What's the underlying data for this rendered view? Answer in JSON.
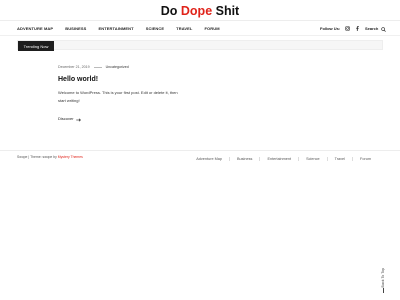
{
  "site": {
    "title_part1": "Do ",
    "title_accent": "Dope",
    "title_part2": " Shit",
    "accent_color": "#e0231a"
  },
  "nav": {
    "items": [
      "ADVENTURE MAP",
      "BUSINESS",
      "ENTERTAINMENT",
      "SCIENCE",
      "TRAVEL",
      "FORUM"
    ]
  },
  "header": {
    "follow_label": "Follow Us:",
    "social_icons": [
      "instagram-icon",
      "facebook-icon"
    ],
    "search_label": "Search",
    "search_icon": "search-icon"
  },
  "ticker": {
    "button_label": "Trending Now"
  },
  "post": {
    "date": "December 21, 2019",
    "category": "Uncategorized",
    "title": "Hello world!",
    "excerpt": "Welcome to WordPress. This is your first post. Edit or delete it, then start writing!",
    "read_more": "Discover"
  },
  "footer": {
    "credit_prefix": "Swope | Theme: swope by ",
    "credit_link": "Mystery Themes",
    "nav": [
      "Adventure Map",
      "Business",
      "Entertainment",
      "Science",
      "Travel",
      "Forum"
    ],
    "back_to_top": "Back To Top"
  }
}
